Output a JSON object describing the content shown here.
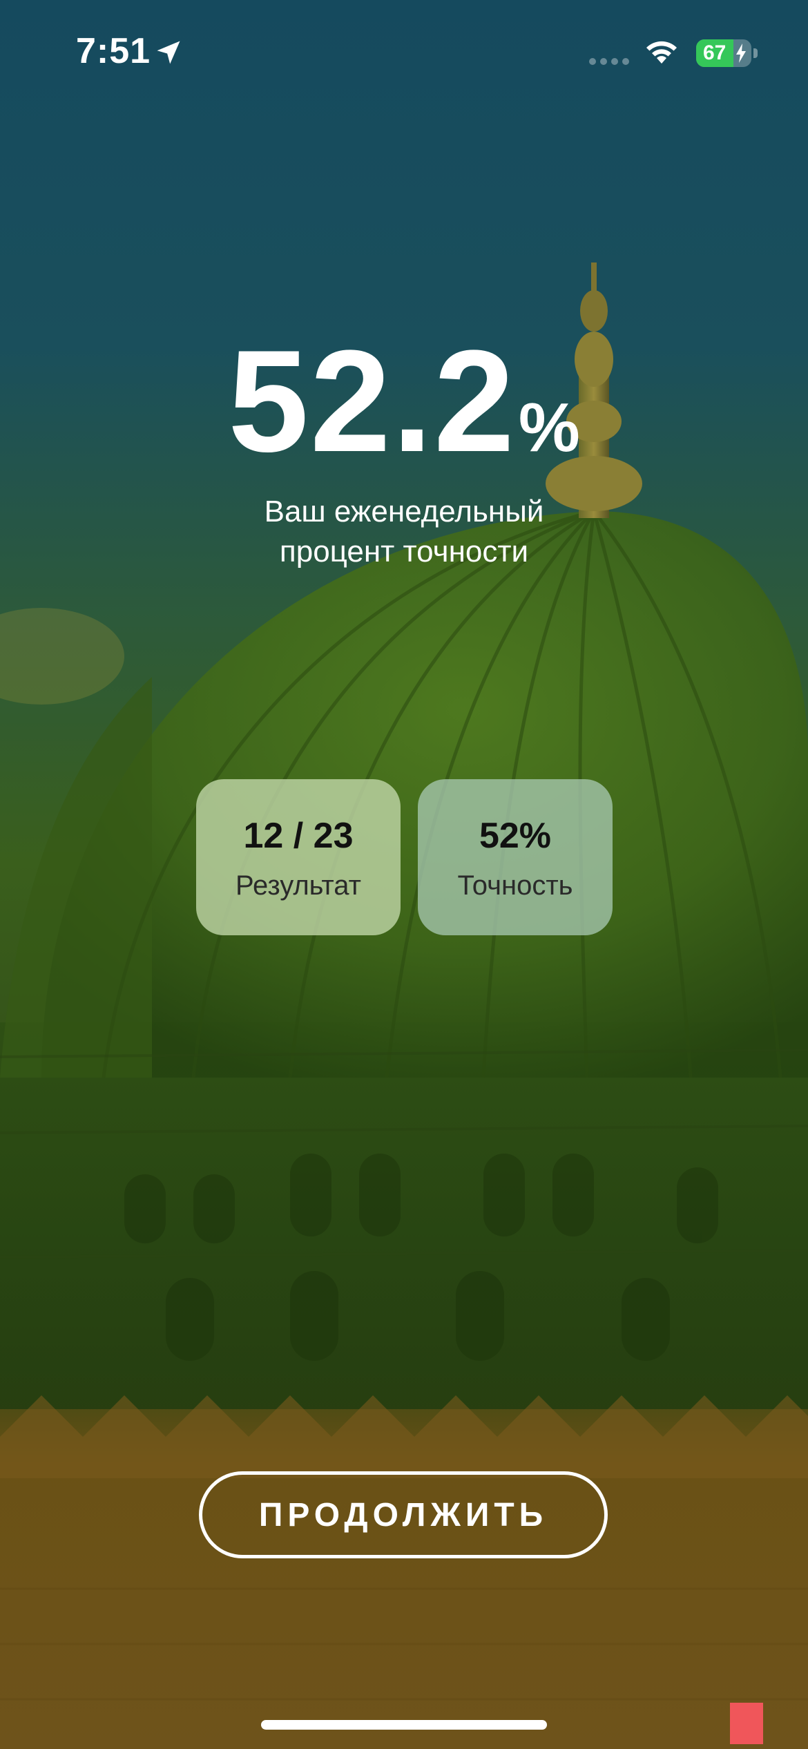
{
  "status_bar": {
    "time": "7:51",
    "battery_percent": 67,
    "battery_label": "67",
    "location_icon": "location-arrow-icon",
    "wifi_icon": "wifi-icon",
    "signal_icon": "cellular-signal-icon",
    "charging_icon": "bolt-icon"
  },
  "summary": {
    "percent_value": "52.2",
    "percent_symbol": "%",
    "subtitle_line1": "Ваш еженедельный",
    "subtitle_line2": "процент точности"
  },
  "stats": {
    "result": {
      "value": "12 / 23",
      "label": "Результат"
    },
    "accuracy": {
      "value": "52%",
      "label": "Точность"
    }
  },
  "actions": {
    "continue_label": "ПРОДОЛЖИТЬ"
  },
  "colors": {
    "accent": "#ffffff",
    "battery_green": "#35c759",
    "card_result_bg": "#c4daac",
    "card_accuracy_bg": "#accbb6"
  }
}
